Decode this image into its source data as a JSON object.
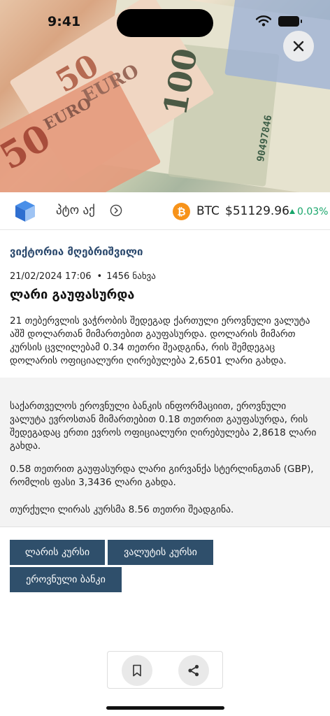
{
  "status_bar": {
    "time": "9:41"
  },
  "hero": {
    "banknote_texts": [
      "50",
      "EURO",
      "50",
      "EURO",
      "100",
      "90497846"
    ]
  },
  "ticker": {
    "link_text": "პტო აქ",
    "crypto_symbol": "BTC",
    "crypto_price": "$51129.96",
    "crypto_change": "0.03%",
    "colors": {
      "btc": "#f7931a",
      "positive": "#18a66b"
    }
  },
  "article": {
    "author": "ვიქტორია მღებრიშვილი",
    "date": "21/02/2024 17:06",
    "views": "1456 ნახვა",
    "title": "ლარი გაუფასურდა",
    "paragraphs": [
      "21 თებერვლის ვაჭრობის შედეგად ქართული ეროვნული ვალუტა აშშ დოლართან მიმართებით გაუფასურდა. დოლარის მიმართ კურსის ცვლილებამ 0.34 თეთრი შეადგინა, რის შემდეგაც დოლარის ოფიციალური ღირებულება 2,6501 ლარი გახდა.",
      "საქართველოს ეროვნული ბანკის ინფორმაციით, ეროვნული ვალუტა ევროსთან მიმართებით 0.18 თეთრით გაუფასურდა, რის შედეგადაც ერთი ევროს ოფიციალური ღირებულება 2,8618 ლარი გახდა.",
      "0.58 თეთრით გაუფასურდა ლარი გირვანქა სტერლინგთან (GBP), რომლის ფასი 3,3436 ლარი გახდა.",
      "თურქული ლირას კურსმა 8.56 თეთრი შეადგინა."
    ]
  },
  "tags": [
    "ლარის კურსი",
    "ვალუტის კურსი",
    "ეროვნული ბანკი"
  ],
  "colors": {
    "tag_bg": "#2f4f6b",
    "author": "#2c4a6e"
  }
}
